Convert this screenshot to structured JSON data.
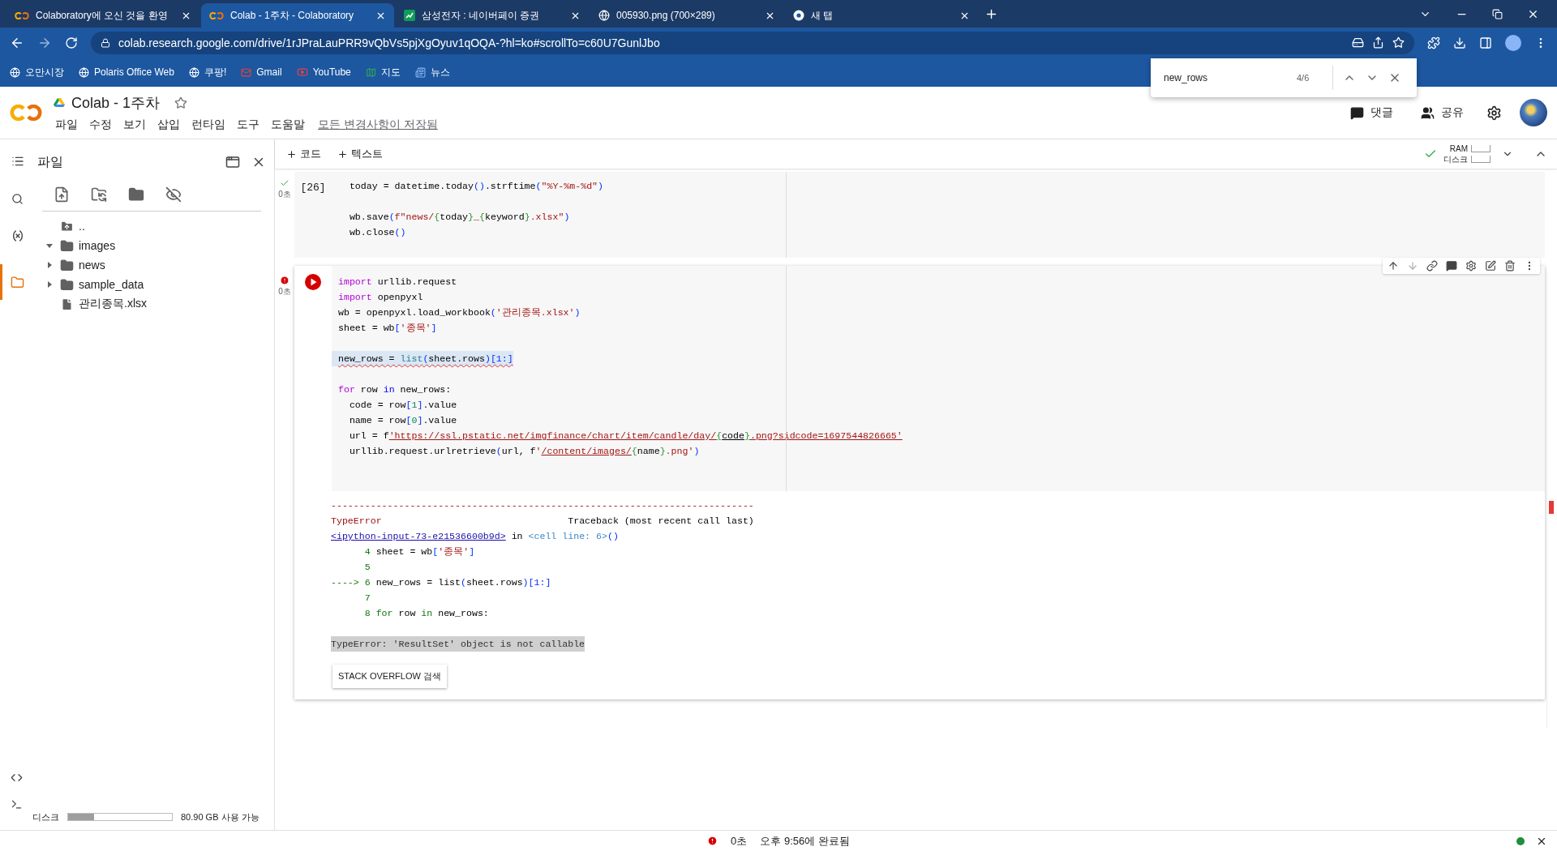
{
  "browser": {
    "tabs": [
      {
        "title": "Colaboratory에 오신 것을 환영",
        "kind": "colab",
        "selected": false
      },
      {
        "title": "Colab - 1주차 - Colaboratory",
        "kind": "colab",
        "selected": true
      },
      {
        "title": "삼성전자 : 네이버페이 증권",
        "kind": "sheet",
        "selected": false
      },
      {
        "title": "005930.png (700×289)",
        "kind": "globe",
        "selected": false
      },
      {
        "title": "새 탭",
        "kind": "chrome",
        "selected": false
      }
    ],
    "url": "colab.research.google.com/drive/1rJPraLauPRR9vQbVs5pjXgOyuv1qOQA-?hl=ko#scrollTo=c60U7GunlJbo",
    "bookmarks": [
      {
        "label": "오만시장",
        "kind": "globe"
      },
      {
        "label": "Polaris Office Web",
        "kind": "globe"
      },
      {
        "label": "쿠팡!",
        "kind": "globe"
      },
      {
        "label": "Gmail",
        "kind": "gmail"
      },
      {
        "label": "YouTube",
        "kind": "youtube"
      },
      {
        "label": "지도",
        "kind": "maps"
      },
      {
        "label": "뉴스",
        "kind": "news"
      }
    ],
    "find_bar": {
      "query": "new_rows",
      "count": "4/6"
    }
  },
  "colab": {
    "title": "Colab - 1주차",
    "starred": false,
    "menu": [
      "파일",
      "수정",
      "보기",
      "삽입",
      "런타임",
      "도구",
      "도움말"
    ],
    "save_status": "모든 변경사항이 저장됨",
    "actions": [
      {
        "label": "댓글",
        "kind": "comment"
      },
      {
        "label": "공유",
        "kind": "share"
      }
    ],
    "add_buttons": [
      "코드",
      "텍스트"
    ],
    "resources": {
      "ram": "RAM",
      "disk": "디스크",
      "connected": true
    }
  },
  "sidebar": {
    "rail": [
      {
        "kind": "toc",
        "selected": false
      },
      {
        "kind": "search",
        "selected": false
      },
      {
        "kind": "variables",
        "selected": false
      },
      {
        "kind": "files",
        "selected": true
      }
    ],
    "panel_title": "파일",
    "files": [
      {
        "name": "..",
        "kind": "up"
      },
      {
        "name": "images",
        "kind": "folder",
        "expanded": true
      },
      {
        "name": "news",
        "kind": "folder",
        "expanded": false
      },
      {
        "name": "sample_data",
        "kind": "folder",
        "expanded": false
      },
      {
        "name": "관리종목.xlsx",
        "kind": "file"
      }
    ],
    "disk": {
      "label": "디스크",
      "level": 0.25,
      "free": "80.90 GB 사용 가능"
    }
  },
  "cells": [
    {
      "kind": "succeeded",
      "count": "[26]",
      "time": "0초",
      "selected": false,
      "lines": [
        {
          "kind": "code",
          "tokens": [
            {
              "kind": "p",
              "t": "  today = datetime.today"
            },
            {
              "kind": "b",
              "t": "()"
            },
            {
              "kind": "p",
              "t": ".strftime"
            },
            {
              "kind": "b",
              "t": "("
            },
            {
              "kind": "s",
              "t": "\"%Y-%m-%d\""
            },
            {
              "kind": "b",
              "t": ")"
            }
          ]
        },
        {
          "kind": "blank"
        },
        {
          "kind": "code",
          "tokens": [
            {
              "kind": "p",
              "t": "  wb.save"
            },
            {
              "kind": "b",
              "t": "("
            },
            {
              "kind": "s",
              "t": "f\"news/"
            },
            {
              "kind": "g",
              "t": "{"
            },
            {
              "kind": "p",
              "t": "today"
            },
            {
              "kind": "g",
              "t": "}"
            },
            {
              "kind": "s",
              "t": "_"
            },
            {
              "kind": "g",
              "t": "{"
            },
            {
              "kind": "p",
              "t": "keyword"
            },
            {
              "kind": "g",
              "t": "}"
            },
            {
              "kind": "s",
              "t": ".xlsx\""
            },
            {
              "kind": "b",
              "t": ")"
            }
          ]
        },
        {
          "kind": "code",
          "tokens": [
            {
              "kind": "p",
              "t": "  wb.close"
            },
            {
              "kind": "b",
              "t": "()"
            }
          ]
        }
      ]
    },
    {
      "kind": "failed",
      "time": "0초",
      "selected": true,
      "lines": [
        {
          "kind": "code",
          "tokens": [
            {
              "kind": "kw",
              "t": "import"
            },
            {
              "kind": "p",
              "t": " urllib.request"
            }
          ]
        },
        {
          "kind": "code",
          "tokens": [
            {
              "kind": "kw",
              "t": "import"
            },
            {
              "kind": "p",
              "t": " openpyxl"
            }
          ]
        },
        {
          "kind": "code",
          "tokens": [
            {
              "kind": "p",
              "t": "wb = openpyxl.load_workbook"
            },
            {
              "kind": "b",
              "t": "("
            },
            {
              "kind": "s",
              "t": "'관리종목.xlsx'"
            },
            {
              "kind": "b",
              "t": ")"
            }
          ]
        },
        {
          "kind": "code",
          "tokens": [
            {
              "kind": "p",
              "t": "sheet = wb"
            },
            {
              "kind": "b",
              "t": "["
            },
            {
              "kind": "s",
              "t": "'종목'"
            },
            {
              "kind": "b",
              "t": "]"
            }
          ]
        },
        {
          "kind": "blank"
        },
        {
          "kind": "code",
          "flagged": true,
          "tokens": [
            {
              "kind": "p",
              "t": "new_rows = "
            },
            {
              "kind": "f",
              "t": "list"
            },
            {
              "kind": "b",
              "t": "("
            },
            {
              "kind": "p",
              "t": "sheet.rows"
            },
            {
              "kind": "b",
              "t": ")[1:]"
            }
          ]
        },
        {
          "kind": "blank"
        },
        {
          "kind": "code",
          "tokens": [
            {
              "kind": "kw",
              "t": "for"
            },
            {
              "kind": "p",
              "t": " row "
            },
            {
              "kind": "kb",
              "t": "in"
            },
            {
              "kind": "p",
              "t": " new_rows:"
            }
          ]
        },
        {
          "kind": "code",
          "tokens": [
            {
              "kind": "p",
              "t": "  code = row"
            },
            {
              "kind": "b",
              "t": "["
            },
            {
              "kind": "n",
              "t": "1"
            },
            {
              "kind": "b",
              "t": "]"
            },
            {
              "kind": "p",
              "t": ".value"
            }
          ]
        },
        {
          "kind": "code",
          "tokens": [
            {
              "kind": "p",
              "t": "  name = row"
            },
            {
              "kind": "b",
              "t": "["
            },
            {
              "kind": "n",
              "t": "0"
            },
            {
              "kind": "b",
              "t": "]"
            },
            {
              "kind": "p",
              "t": ".value"
            }
          ]
        },
        {
          "kind": "code",
          "tokens": [
            {
              "kind": "p",
              "t": "  url = f"
            },
            {
              "kind": "su",
              "t": "'https://ssl.pstatic.net/imgfinance/chart/item/candle/day/"
            },
            {
              "kind": "gu",
              "t": "{"
            },
            {
              "kind": "pu",
              "t": "code"
            },
            {
              "kind": "gu",
              "t": "}"
            },
            {
              "kind": "su",
              "t": ".png?sidcode=1697544826665'"
            }
          ]
        },
        {
          "kind": "code",
          "tokens": [
            {
              "kind": "p",
              "t": "  urllib.request.urlretrieve"
            },
            {
              "kind": "b",
              "t": "("
            },
            {
              "kind": "p",
              "t": "url, f"
            },
            {
              "kind": "s",
              "t": "'"
            },
            {
              "kind": "su",
              "t": "/content/images/"
            },
            {
              "kind": "g",
              "t": "{"
            },
            {
              "kind": "p",
              "t": "name"
            },
            {
              "kind": "g",
              "t": "}"
            },
            {
              "kind": "s",
              "t": ".png'"
            },
            {
              "kind": "b",
              "t": ")"
            }
          ]
        }
      ],
      "output": {
        "lines": [
          {
            "kind": "code",
            "tokens": [
              {
                "kind": "r",
                "t": "---------------------------------------------------------------------------"
              }
            ]
          },
          {
            "kind": "code",
            "tokens": [
              {
                "kind": "r",
                "t": "TypeError"
              },
              {
                "kind": "p",
                "t": "                                 Traceback (most recent call last)"
              }
            ]
          },
          {
            "kind": "code",
            "tokens": [
              {
                "kind": "link",
                "t": "<ipython-input-73-e21536600b9d>"
              },
              {
                "kind": "p",
                "t": " in "
              },
              {
                "kind": "cl",
                "t": "<cell line: 6>"
              },
              {
                "kind": "b",
                "t": "()"
              }
            ]
          },
          {
            "kind": "code",
            "tokens": [
              {
                "kind": "gn",
                "t": "      4 "
              },
              {
                "kind": "p",
                "t": "sheet = wb"
              },
              {
                "kind": "b",
                "t": "["
              },
              {
                "kind": "s",
                "t": "'종목'"
              },
              {
                "kind": "b",
                "t": "]"
              }
            ]
          },
          {
            "kind": "code",
            "tokens": [
              {
                "kind": "gn",
                "t": "      5"
              }
            ]
          },
          {
            "kind": "code",
            "tokens": [
              {
                "kind": "gn",
                "t": "----> 6 "
              },
              {
                "kind": "p",
                "t": "new_rows = list"
              },
              {
                "kind": "b",
                "t": "("
              },
              {
                "kind": "p",
                "t": "sheet.rows"
              },
              {
                "kind": "b",
                "t": ")[1:]"
              }
            ]
          },
          {
            "kind": "code",
            "tokens": [
              {
                "kind": "gn",
                "t": "      7"
              }
            ]
          },
          {
            "kind": "code",
            "tokens": [
              {
                "kind": "gn",
                "t": "      8 for"
              },
              {
                "kind": "p",
                "t": " row "
              },
              {
                "kind": "gn",
                "t": "in"
              },
              {
                "kind": "p",
                "t": " new_rows:"
              }
            ]
          }
        ],
        "error": "TypeError: 'ResultSet' object is not callable",
        "button": "STACK OVERFLOW 검색"
      }
    }
  ],
  "status_bar": {
    "kind": "failed",
    "elapsed": "0초",
    "finished": "오후 9:56에 완료됨",
    "connected": true
  }
}
